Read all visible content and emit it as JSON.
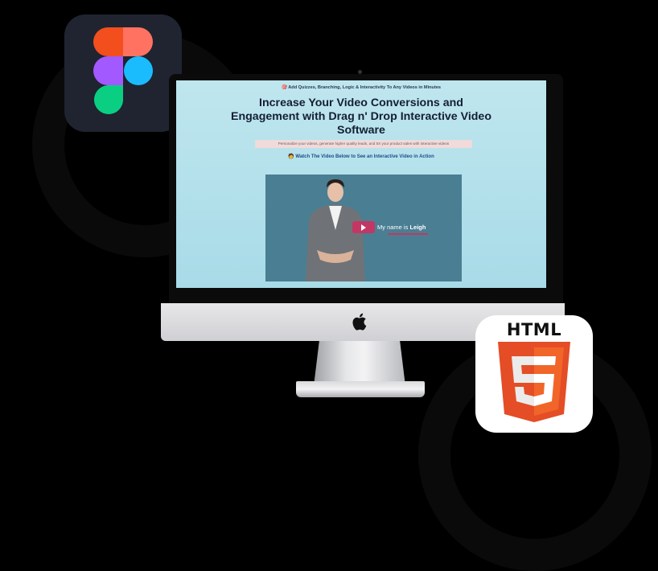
{
  "colors": {
    "figma_red": "#f24e1e",
    "figma_orange": "#ff7262",
    "figma_purple": "#a259ff",
    "figma_blue": "#1abcfe",
    "figma_green": "#0acf83",
    "html5_orange": "#e44d26",
    "html5_light": "#f16529",
    "video_accent": "#c33765",
    "screen_bg": "#bfe6ee"
  },
  "icons": {
    "figma": "figma-logo-icon",
    "html5": "html5-logo-icon",
    "apple": "apple-logo-icon",
    "play": "play-icon"
  },
  "screen": {
    "top_note": "🎯 Add Quizzes, Branching, Logic & Interactivity To Any Videos in Minutes",
    "headline": "Increase Your Video Conversions and Engagement with Drag n' Drop Interactive Video Software",
    "sub_banner": "Personalize your videos, generate higher quality leads, and 5X your product sales with interactive videos",
    "watch_line": "🧑 Watch The Video Below to See an Interactive Video in Action",
    "video": {
      "caption_prefix": "My name is ",
      "caption_name": "Leigh"
    }
  },
  "html_badge": {
    "label": "HTML",
    "shield_number": "5"
  }
}
